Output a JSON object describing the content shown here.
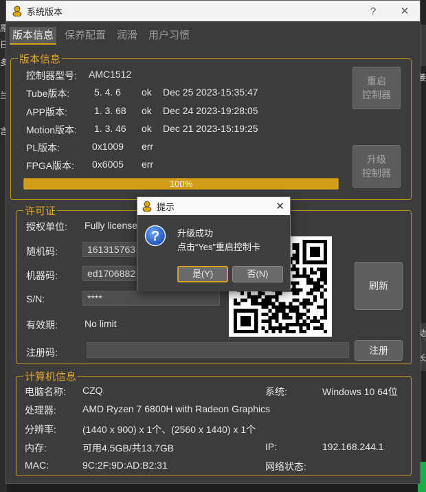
{
  "window": {
    "title": "系统版本",
    "help": "?",
    "close": "✕"
  },
  "tabs": [
    {
      "label": "版本信息",
      "active": true
    },
    {
      "label": "保养配置",
      "active": false
    },
    {
      "label": "润滑",
      "active": false
    },
    {
      "label": "用户习惯",
      "active": false
    }
  ],
  "version": {
    "legend": "版本信息",
    "controller_label": "控制器型号:",
    "controller_value": "AMC1512",
    "rows": [
      {
        "name": "Tube版本:",
        "version": "5. 4. 6",
        "status": "ok",
        "date": "Dec 25 2023-15:35:47"
      },
      {
        "name": "APP版本:",
        "version": "1. 3. 68",
        "status": "ok",
        "date": "Dec 24 2023-19:28:05"
      },
      {
        "name": "Motion版本:",
        "version": "1. 3. 46",
        "status": "ok",
        "date": "Dec 21 2023-15:19:25"
      },
      {
        "name": "PL版本:",
        "version": "0x1009",
        "status": "err",
        "date": ""
      },
      {
        "name": "FPGA版本:",
        "version": "0x6005",
        "status": "err",
        "date": ""
      }
    ],
    "restart_button": "重启\n控制器",
    "upgrade_button": "升级\n控制器",
    "progress_text": "100%",
    "progress_fraction": 1.0
  },
  "license": {
    "legend": "许可证",
    "unit_label": "授权单位:",
    "unit_value": "Fully license",
    "random_label": "随机码:",
    "random_value": "161315763",
    "machine_label": "机器码:",
    "machine_value": "ed1706882",
    "sn_label": "S/N:",
    "sn_value": "****",
    "validity_label": "有效期:",
    "validity_value": "No limit",
    "refresh_button": "刷新",
    "regcode_label": "注册码:",
    "regcode_value": "",
    "register_button": "注册"
  },
  "computer": {
    "legend": "计算机信息",
    "name_label": "电脑名称:",
    "name_value": "CZQ",
    "system_label": "系统:",
    "system_value": "Windows 10 64位",
    "cpu_label": "处理器:",
    "cpu_value": "AMD Ryzen 7 6800H with Radeon Graphics",
    "resolution_label": "分辨率:",
    "resolution_value": "(1440 x 900) x 1个、(2560 x 1440) x 1个",
    "memory_label": "内存:",
    "memory_value": "可用4.5GB/共13.7GB",
    "ip_label": "IP:",
    "ip_value": "192.168.244.1",
    "mac_label": "MAC:",
    "mac_value": "9C:2F:9D:AD:B2:31",
    "network_label": "网络状态:",
    "network_value": ""
  },
  "dialog": {
    "title": "提示",
    "message_line1": "升级成功",
    "message_line2": "点击“Yes”重启控制卡",
    "yes_button": "是(Y)",
    "no_button": "否(N)",
    "close": "✕"
  },
  "background": {
    "left_chars": [
      "原",
      "日",
      "多",
      "兰",
      "言"
    ],
    "right_chars": [
      "萎",
      "动",
      "长"
    ]
  },
  "colors": {
    "accent": "#d4a017",
    "window_bg": "#3c3c3c"
  }
}
